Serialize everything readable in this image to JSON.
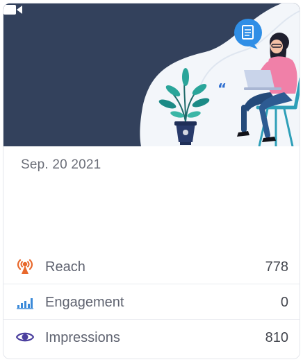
{
  "card": {
    "date": "Sep. 20 2021",
    "media_type_icon": "video-camera-icon",
    "illustration": "woman-with-laptop-and-plant"
  },
  "metrics": [
    {
      "label": "Reach",
      "value": "778",
      "icon": "reach-antenna-icon",
      "color": "#e8682c"
    },
    {
      "label": "Engagement",
      "value": "0",
      "icon": "engagement-bars-icon",
      "color": "#3b8ad9"
    },
    {
      "label": "Impressions",
      "value": "810",
      "icon": "eye-icon",
      "color": "#4b3f9e"
    }
  ],
  "colors": {
    "hero_background": "#33415c",
    "accent_blue": "#2f8ee6",
    "teal_chair": "#2e9fb8"
  }
}
